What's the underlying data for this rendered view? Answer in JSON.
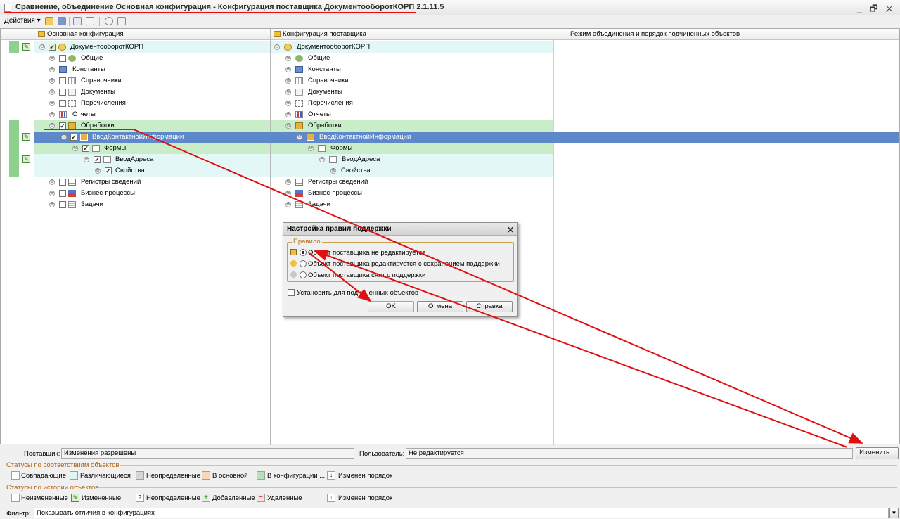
{
  "window": {
    "title": "Сравнение, объединение Основная конфигурация - Конфигурация поставщика ДокументооборотКОРП 2.1.11.5",
    "controls": "_ 🗗 ✕"
  },
  "toolbar": {
    "actions_label": "Действия ▾"
  },
  "columns": {
    "main": "Основная конфигурация",
    "vendor": "Конфигурация поставщика",
    "mode": "Режим объединения и порядок подчиненных объектов"
  },
  "tree_left": [
    {
      "label": "ДокументооборотКОРП",
      "exp": "⊖",
      "chk": "✓"
    },
    {
      "label": "Общие",
      "exp": "⊕",
      "chk": ""
    },
    {
      "label": "Константы",
      "exp": "⊕",
      "chk": ""
    },
    {
      "label": "Справочники",
      "exp": "⊕",
      "chk": ""
    },
    {
      "label": "Документы",
      "exp": "⊕",
      "chk": ""
    },
    {
      "label": "Перечисления",
      "exp": "⊕",
      "chk": ""
    },
    {
      "label": "Отчеты",
      "exp": "⊕",
      "chk": ""
    },
    {
      "label": "Обработки",
      "exp": "⊖",
      "chk": "✓"
    },
    {
      "label": "ВводКонтактнойИнформации",
      "exp": "⊖",
      "chk": "✓"
    },
    {
      "label": "Формы",
      "exp": "⊖",
      "chk": "✓"
    },
    {
      "label": "ВводАдреса",
      "exp": "⊖",
      "chk": "✓"
    },
    {
      "label": "Свойства",
      "exp": "⊕",
      "chk": "✓"
    },
    {
      "label": "Регистры сведений",
      "exp": "⊕",
      "chk": ""
    },
    {
      "label": "Бизнес-процессы",
      "exp": "⊕",
      "chk": ""
    },
    {
      "label": "Задачи",
      "exp": "⊕",
      "chk": ""
    }
  ],
  "tree_right": [
    {
      "label": "ДокументооборотКОРП",
      "exp": "⊖"
    },
    {
      "label": "Общие",
      "exp": "⊕"
    },
    {
      "label": "Константы",
      "exp": "⊕"
    },
    {
      "label": "Справочники",
      "exp": "⊕"
    },
    {
      "label": "Документы",
      "exp": "⊕"
    },
    {
      "label": "Перечисления",
      "exp": "⊕"
    },
    {
      "label": "Отчеты",
      "exp": "⊕"
    },
    {
      "label": "Обработки",
      "exp": "⊖"
    },
    {
      "label": "ВводКонтактнойИнформации",
      "exp": "⊖"
    },
    {
      "label": "Формы",
      "exp": "⊖"
    },
    {
      "label": "ВводАдреса",
      "exp": "⊖"
    },
    {
      "label": "Свойства",
      "exp": "⊕"
    },
    {
      "label": "Регистры сведений",
      "exp": "⊕"
    },
    {
      "label": "Бизнес-процессы",
      "exp": "⊕"
    },
    {
      "label": "Задачи",
      "exp": "⊕"
    }
  ],
  "dialog": {
    "title": "Настройка правил поддержки",
    "close": "✕",
    "group_label": "Правило",
    "options": [
      "Объект поставщика не редактируется",
      "Объект поставщика редактируется с сохранением поддержки",
      "Объект поставщика снят с поддержки"
    ],
    "selected_option": 0,
    "apply_children": "Установить для подчиненных объектов",
    "ok": "OK",
    "cancel": "Отмена",
    "help": "Справка"
  },
  "bottom": {
    "vendor_label": "Поставщик:",
    "vendor_value": "Изменения разрешены",
    "user_label": "Пользователь:",
    "user_value": "Не редактируется",
    "change_button": "Изменить..."
  },
  "legend_match": {
    "title": "Статусы по соответствиям объектов",
    "items": [
      "Совпадающие",
      "Различающиеся",
      "Неопределенные",
      "В основной",
      "В конфигурации ...",
      "Изменен порядок"
    ],
    "colors": [
      "#ffffff",
      "#dff6f6",
      "#d6d6d6",
      "#f8d8b8",
      "#b8e0b8",
      "#ffffff"
    ]
  },
  "legend_history": {
    "title": "Статусы по истории объектов",
    "items": [
      "Неизмененные",
      "Измененные",
      "Неопределенные",
      "Добавленные",
      "Удаленные",
      "Изменен порядок"
    ]
  },
  "filter": {
    "label": "Фильтр:",
    "value": "Показывать отличия в конфигурациях"
  },
  "colors": {
    "selection": "#5d88c9",
    "annotation": "#e01010",
    "changed_mark": "#8ed18e"
  }
}
